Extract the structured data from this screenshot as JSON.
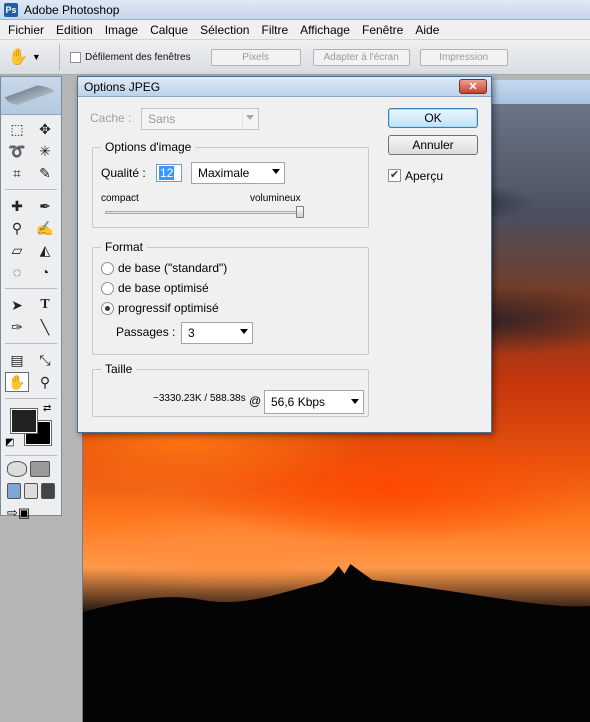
{
  "app": {
    "title": "Adobe Photoshop"
  },
  "menu": [
    "Fichier",
    "Edition",
    "Image",
    "Calque",
    "Sélection",
    "Filtre",
    "Affichage",
    "Fenêtre",
    "Aide"
  ],
  "options_bar": {
    "scroll_all_label": "Défilement des fenêtres",
    "buttons": [
      "Pixels",
      "Adapter à l'écran",
      "Impression"
    ]
  },
  "dialog": {
    "title": "Options JPEG",
    "close_label": "✕",
    "cache_label": "Cache :",
    "cache_value": "Sans",
    "image_options": {
      "title": "Options d'image",
      "quality_label": "Qualité :",
      "quality_value": "12",
      "quality_preset": "Maximale",
      "slider_min_label": "compact",
      "slider_max_label": "volumineux",
      "slider_level": 1.0
    },
    "format": {
      "title": "Format",
      "options": [
        "de base  (\"standard\")",
        "de base optimisé",
        "progressif optimisé"
      ],
      "selected_index": 2,
      "passes_label": "Passages :",
      "passes_value": "3"
    },
    "size": {
      "title": "Taille",
      "estimate": "~3330.23K / 588.38s",
      "at_symbol": "@",
      "speed": "56,6 Kbps"
    },
    "buttons": {
      "ok": "OK",
      "cancel": "Annuler"
    },
    "preview_label": "Aperçu",
    "preview_checked": true
  }
}
